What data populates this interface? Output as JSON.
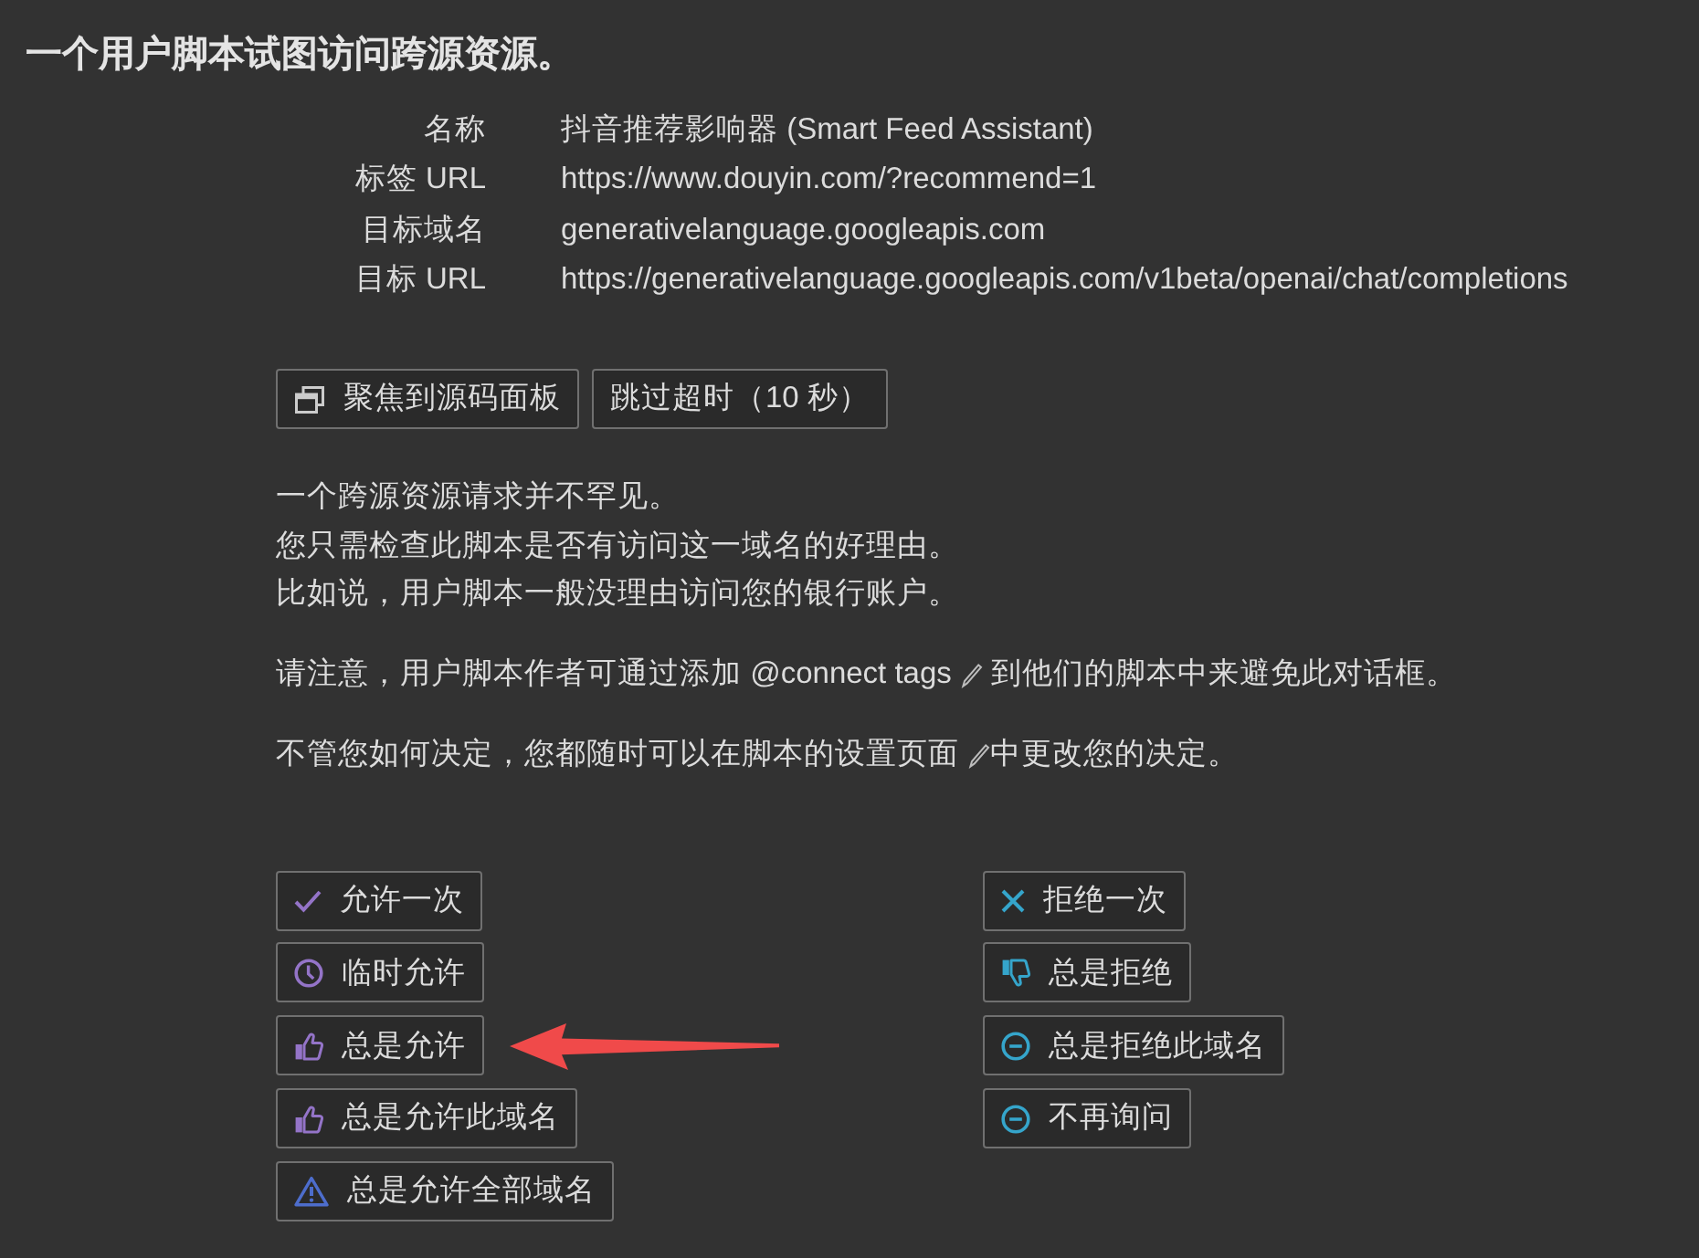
{
  "title": "一个用户脚本试图访问跨源资源。",
  "details": [
    {
      "label": "名称",
      "value": "抖音推荐影响器 (Smart Feed Assistant)"
    },
    {
      "label": "标签 URL",
      "value": "https://www.douyin.com/?recommend=1"
    },
    {
      "label": "目标域名",
      "value": "generativelanguage.googleapis.com"
    },
    {
      "label": "目标 URL",
      "value": "https://generativelanguage.googleapis.com/v1beta/openai/chat/completions"
    }
  ],
  "actions": [
    {
      "kind": "focus",
      "label": "聚焦到源码面板"
    },
    {
      "kind": "skip",
      "label": "跳过超时（10 秒）"
    }
  ],
  "paragraphs": [
    {
      "lines": [
        {
          "parts": [
            {
              "kind": "text",
              "text": "一个跨源资源请求并不罕见。"
            }
          ]
        },
        {
          "parts": [
            {
              "kind": "text",
              "text": "您只需检查此脚本是否有访问这一域名的好理由。"
            }
          ]
        },
        {
          "parts": [
            {
              "kind": "text",
              "text": "比如说，用户脚本一般没理由访问您的银行账户。"
            }
          ]
        }
      ]
    },
    {
      "lines": [
        {
          "parts": [
            {
              "kind": "text",
              "text": "请注意，用户脚本作者可通过添加 "
            },
            {
              "kind": "link",
              "text": "@connect tags"
            },
            {
              "kind": "text",
              "text": " 到他们的脚本中来避免此对话框。"
            }
          ]
        }
      ]
    },
    {
      "lines": [
        {
          "parts": [
            {
              "kind": "text",
              "text": "不管您如何决定，您都随时可以在脚本的"
            },
            {
              "kind": "link",
              "text": "设置页面"
            },
            {
              "kind": "text",
              "text": "中更改您的决定。"
            }
          ]
        }
      ]
    }
  ],
  "allow_options": [
    {
      "kind": "once",
      "label": "允许一次",
      "annotated": false
    },
    {
      "kind": "temporary",
      "label": "临时允许",
      "annotated": false
    },
    {
      "kind": "always",
      "label": "总是允许",
      "annotated": true
    },
    {
      "kind": "domain",
      "label": "总是允许此域名",
      "annotated": false
    },
    {
      "kind": "everywhere",
      "label": "总是允许全部域名",
      "annotated": false
    }
  ],
  "deny_options": [
    {
      "kind": "once",
      "label": "拒绝一次",
      "annotated": false
    },
    {
      "kind": "always",
      "label": "总是拒绝",
      "annotated": false
    },
    {
      "kind": "domain",
      "label": "总是拒绝此域名",
      "annotated": false
    },
    {
      "kind": "never",
      "label": "不再询问",
      "annotated": false
    }
  ]
}
